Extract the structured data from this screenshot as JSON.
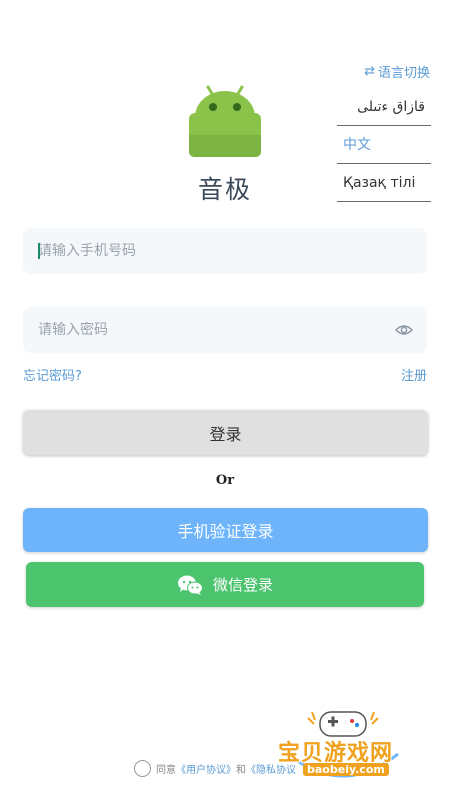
{
  "language": {
    "switch_label": "语言切换",
    "options": [
      "قازاق ءتىلى",
      "中文",
      "Қазақ тілі"
    ],
    "selected": "中文"
  },
  "app": {
    "name": "音极"
  },
  "login_form": {
    "phone_placeholder": "请输入手机号码",
    "password_placeholder": "请输入密码",
    "forgot_password": "忘记密码?",
    "register": "注册",
    "login_button": "登录",
    "or_divider": "Or",
    "phone_code_login": "手机验证登录",
    "wechat_login": "微信登录"
  },
  "agreement": {
    "prefix": "同意",
    "user_agreement": "《用户协议》",
    "and": "和",
    "privacy": "《隐私协议"
  },
  "watermark": {
    "text": "宝贝游戏网",
    "url": "baobeiy.com"
  },
  "colors": {
    "accent_blue": "#5b9bd5",
    "phone_button": "#6db4fb",
    "wechat_green": "#4cc36d",
    "android_green": "#8bc34a"
  }
}
